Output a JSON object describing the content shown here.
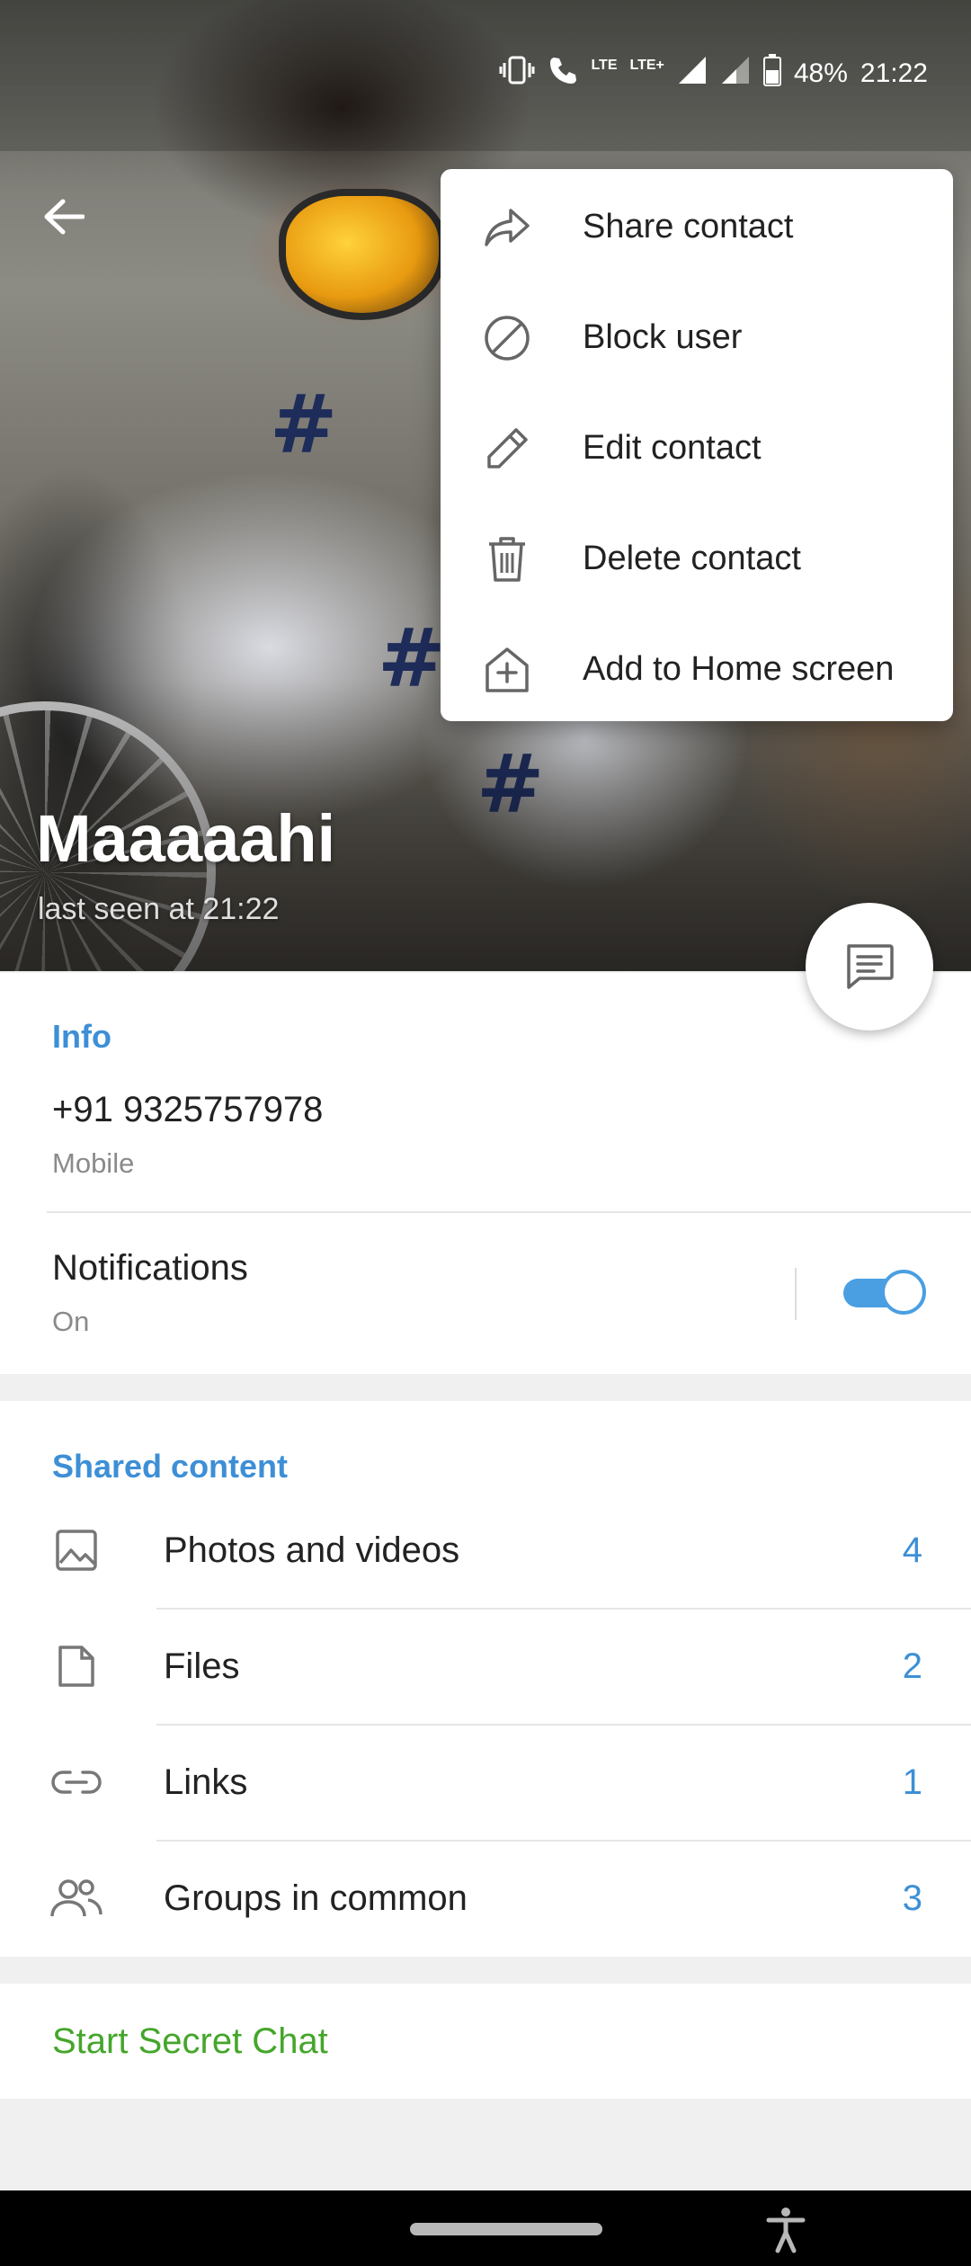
{
  "status_bar": {
    "battery": "48%",
    "time": "21:22",
    "network_label_1": "LTE",
    "network_label_2": "LTE+"
  },
  "profile": {
    "name": "Maaaaahi",
    "last_seen": "last seen at 21:22"
  },
  "menu": {
    "items": [
      {
        "label": "Share contact",
        "icon": "share-icon"
      },
      {
        "label": "Block user",
        "icon": "block-icon"
      },
      {
        "label": "Edit contact",
        "icon": "pencil-icon"
      },
      {
        "label": "Delete contact",
        "icon": "trash-icon"
      },
      {
        "label": "Add to Home screen",
        "icon": "add-home-icon"
      }
    ]
  },
  "info": {
    "title": "Info",
    "phone": "+91 9325757978",
    "phone_type": "Mobile",
    "notifications_label": "Notifications",
    "notifications_value": "On",
    "notifications_enabled": true
  },
  "shared": {
    "title": "Shared content",
    "items": [
      {
        "label": "Photos and videos",
        "count": "4",
        "icon": "photo-icon"
      },
      {
        "label": "Files",
        "count": "2",
        "icon": "file-icon"
      },
      {
        "label": "Links",
        "count": "1",
        "icon": "link-icon"
      },
      {
        "label": "Groups in common",
        "count": "3",
        "icon": "groups-icon"
      }
    ]
  },
  "secret_chat": {
    "label": "Start Secret Chat"
  },
  "colors": {
    "accent_blue": "#3d8fd6",
    "secret_green": "#44a62a",
    "toggle_blue": "#4a9fe2"
  }
}
